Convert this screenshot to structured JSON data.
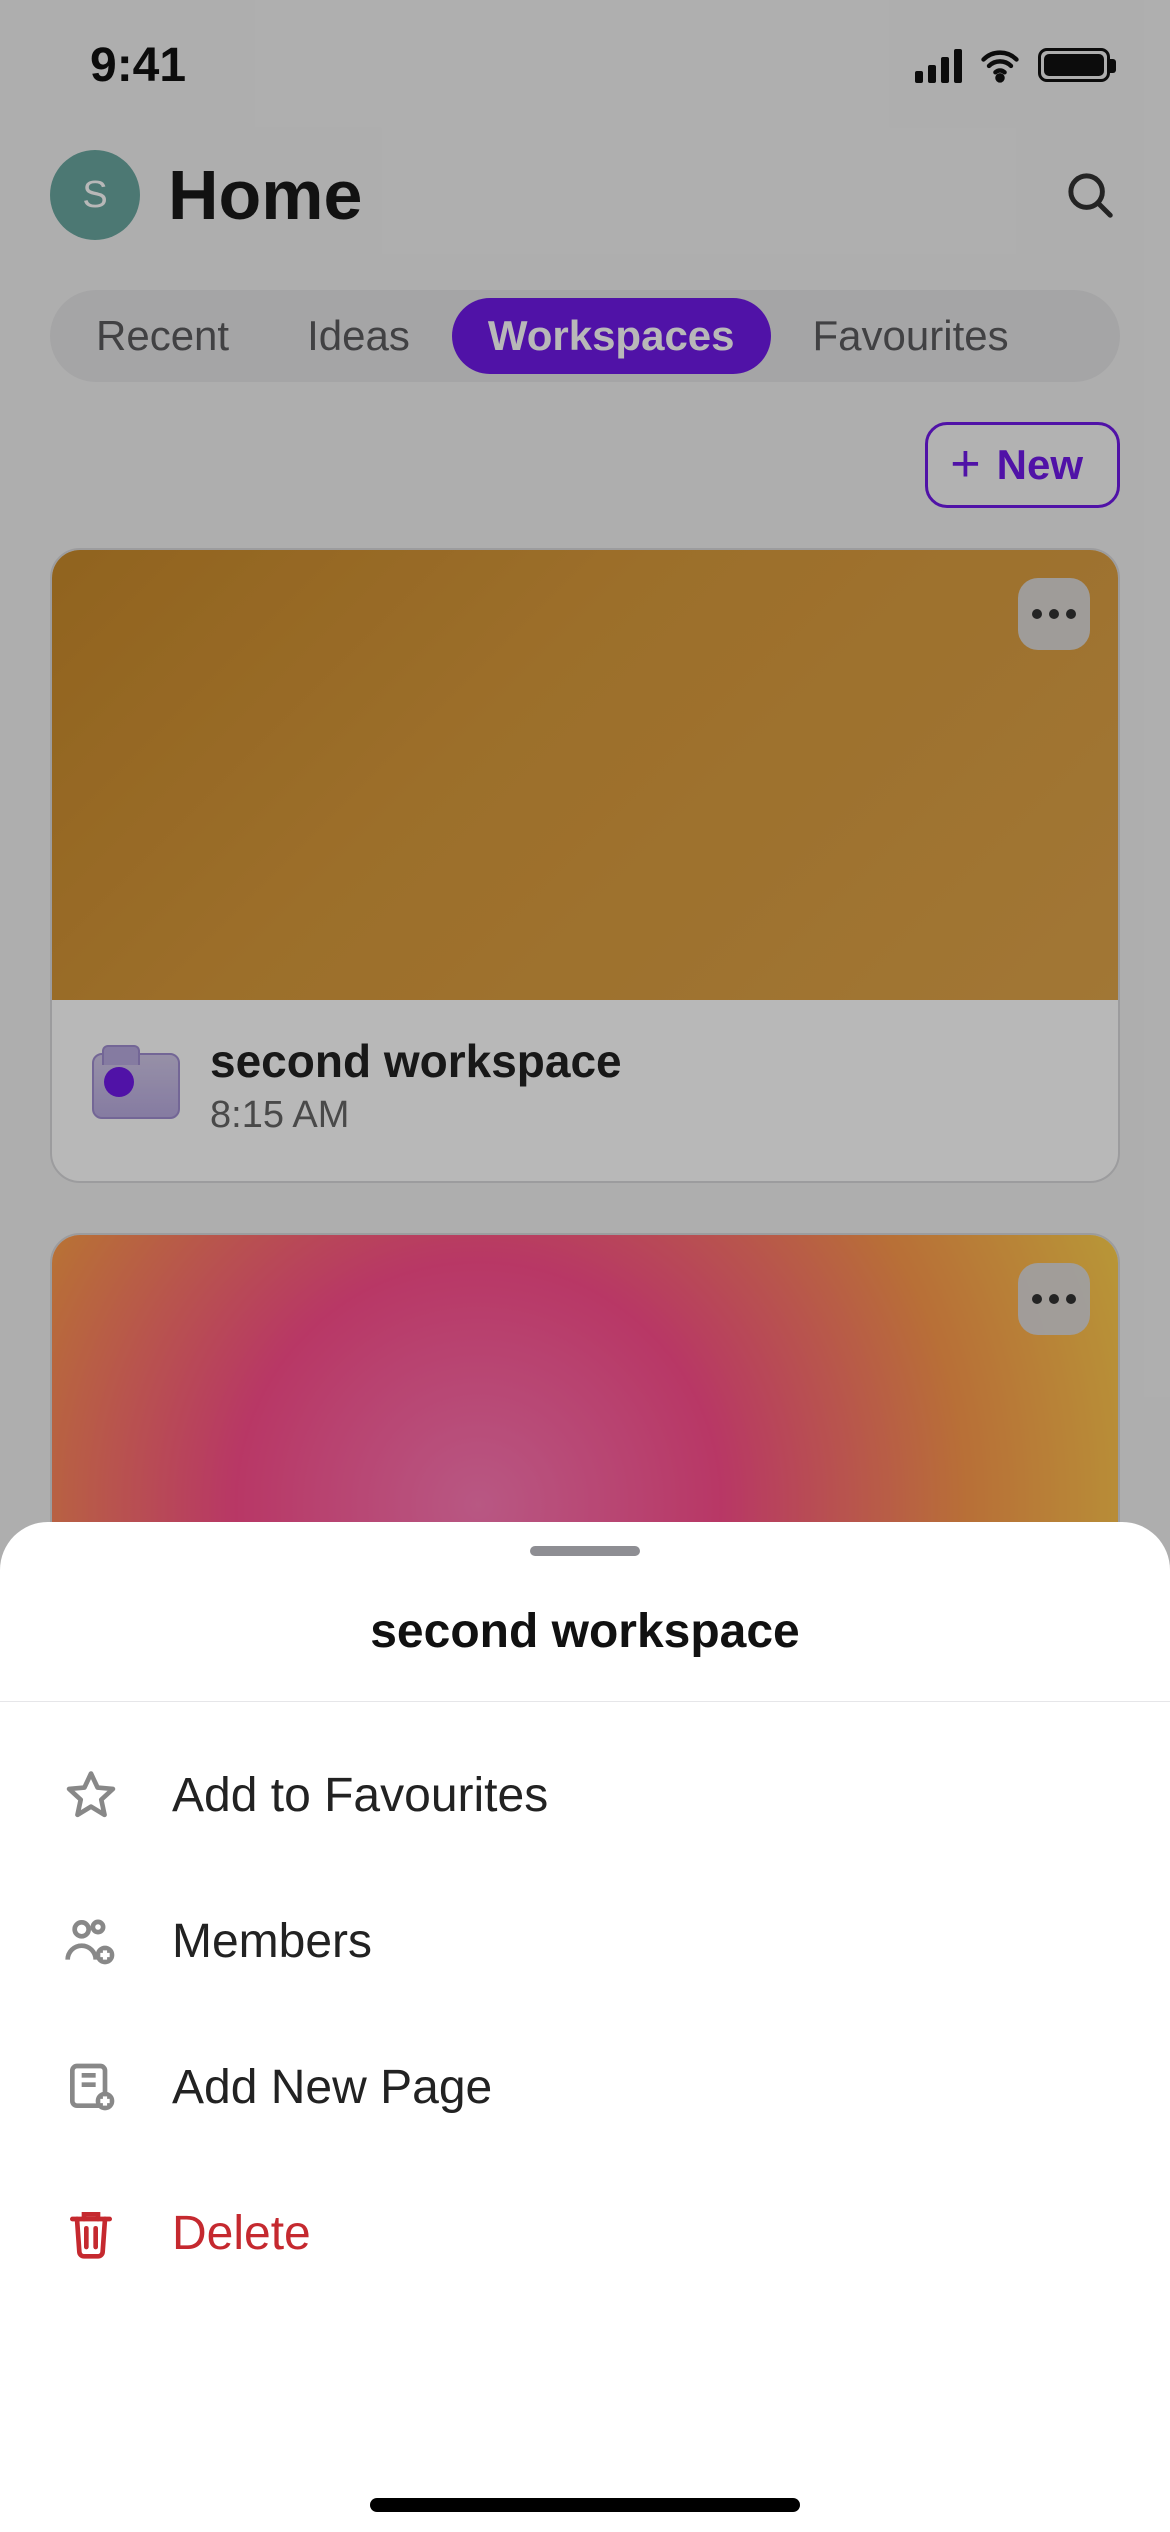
{
  "status": {
    "time": "9:41"
  },
  "header": {
    "avatar_initial": "S",
    "title": "Home"
  },
  "tabs": {
    "items": [
      {
        "label": "Recent"
      },
      {
        "label": "Ideas"
      },
      {
        "label": "Workspaces"
      },
      {
        "label": "Favourites"
      }
    ],
    "active_index": 2
  },
  "new_button": {
    "label": "New"
  },
  "workspaces": [
    {
      "title": "second workspace",
      "subtitle": "8:15 AM"
    }
  ],
  "sheet": {
    "title": "second workspace",
    "items": [
      {
        "key": "favourite",
        "label": "Add to Favourites"
      },
      {
        "key": "members",
        "label": "Members"
      },
      {
        "key": "add_page",
        "label": "Add New Page"
      },
      {
        "key": "delete",
        "label": "Delete"
      }
    ]
  },
  "colors": {
    "accent": "#6f19e8",
    "danger": "#c5292f"
  }
}
